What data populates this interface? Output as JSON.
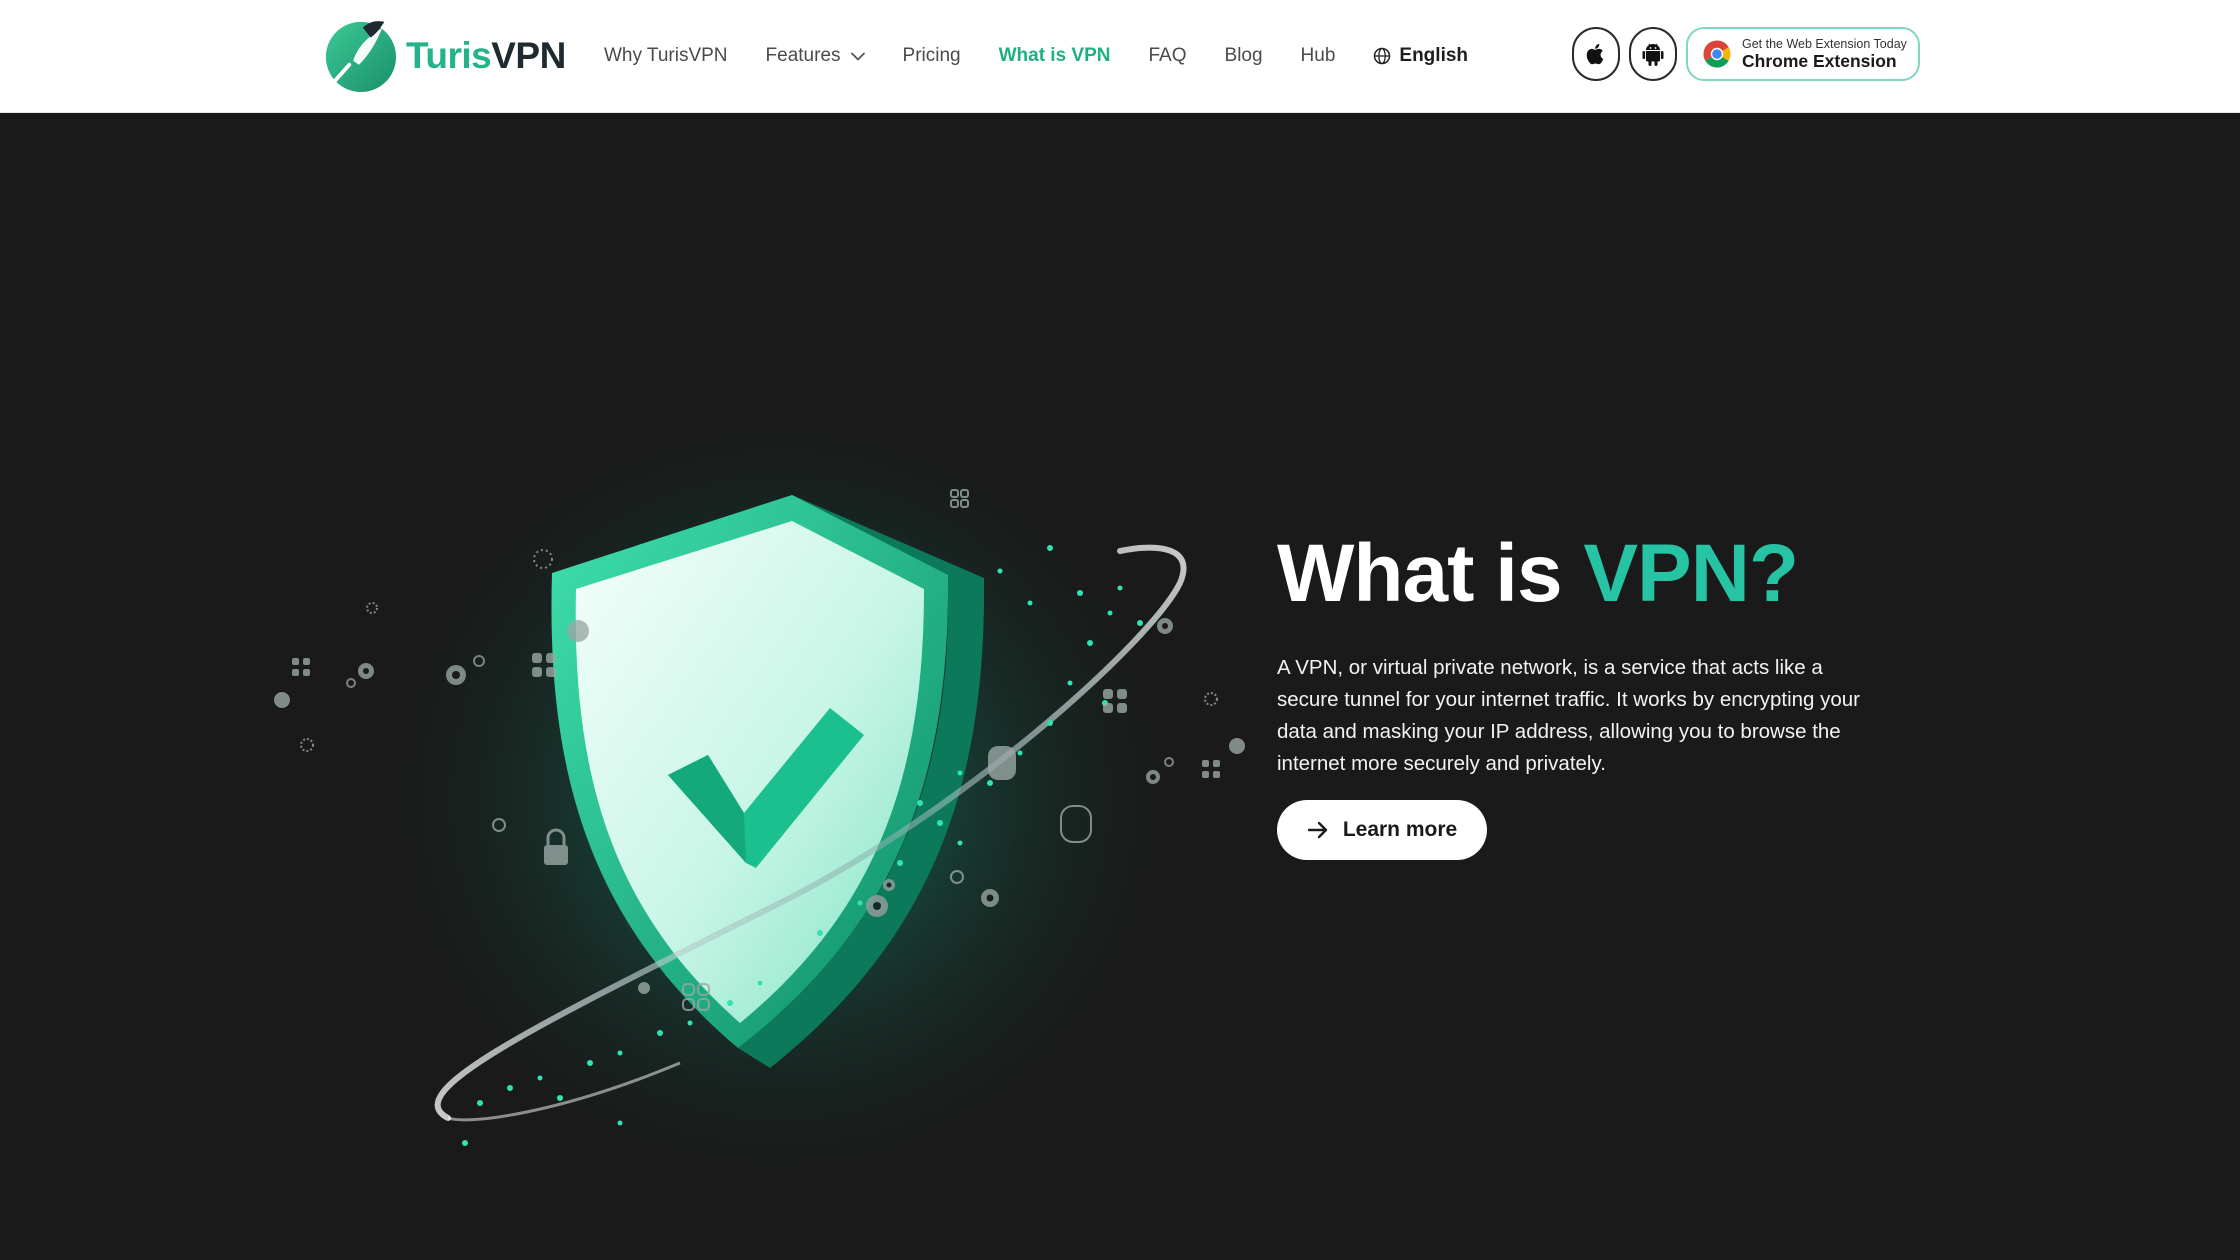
{
  "brand": {
    "name_part1": "Turis",
    "name_part2": "VPN",
    "colors": {
      "primary": "#22b38a",
      "accent": "#26c3a5",
      "dark": "#1a1a1a"
    }
  },
  "nav": {
    "items": [
      {
        "label": "Why TurisVPN",
        "active": false
      },
      {
        "label": "Features",
        "active": false,
        "has_dropdown": true
      },
      {
        "label": "Pricing",
        "active": false
      },
      {
        "label": "What is VPN",
        "active": true
      },
      {
        "label": "FAQ",
        "active": false
      },
      {
        "label": "Blog",
        "active": false
      },
      {
        "label": "Hub",
        "active": false
      }
    ],
    "language": "English"
  },
  "header_actions": {
    "apple_icon": "apple-icon",
    "android_icon": "android-icon",
    "chrome": {
      "icon": "chrome-icon",
      "small_text": "Get the Web Extension Today",
      "big_text": "Chrome Extension"
    }
  },
  "hero": {
    "title_part1": "What is ",
    "title_part2": "VPN?",
    "description": "A VPN, or virtual private network, is a service that acts like a secure tunnel for your internet traffic. It works by encrypting your data and masking your IP address, allowing you to browse the internet more securely and privately.",
    "cta_label": "Learn more",
    "cta_icon": "arrow-right-icon",
    "illustration": "shield-checkmark-illustration"
  }
}
